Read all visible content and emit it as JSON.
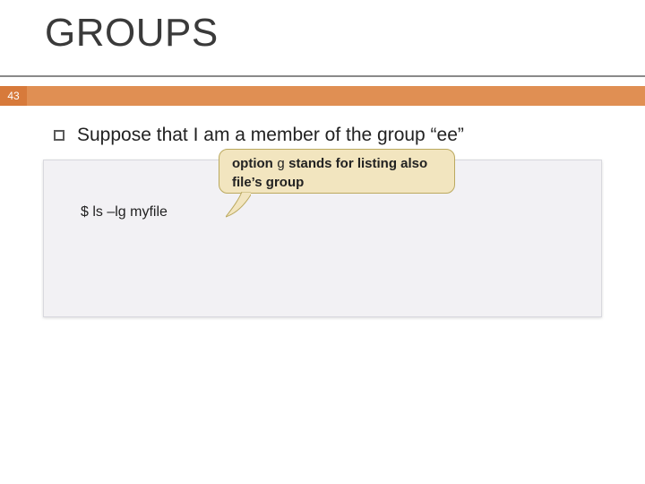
{
  "slide": {
    "title": "GROUPS",
    "page_number": "43",
    "bullet": "Suppose that I am a member of the group “ee”",
    "command": "$ ls –lg myfile",
    "callout_prefix": "option ",
    "callout_option": "g",
    "callout_suffix": " stands for listing also file’s group"
  }
}
